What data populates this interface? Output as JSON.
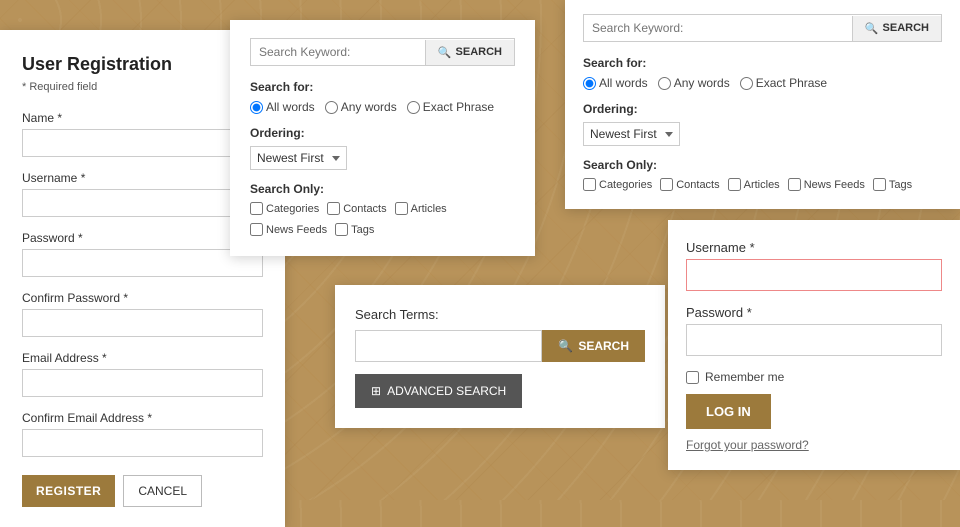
{
  "registration": {
    "title": "User Registration",
    "required_note": "* Required field",
    "fields": [
      {
        "label": "Name *",
        "type": "text",
        "name": "name"
      },
      {
        "label": "Username *",
        "type": "text",
        "name": "username"
      },
      {
        "label": "Password *",
        "type": "password",
        "name": "password"
      },
      {
        "label": "Confirm Password *",
        "type": "password",
        "name": "confirm_password"
      },
      {
        "label": "Email Address *",
        "type": "email",
        "name": "email"
      },
      {
        "label": "Confirm Email Address *",
        "type": "email",
        "name": "confirm_email"
      }
    ],
    "register_btn": "REGISTER",
    "cancel_btn": "CANCEL"
  },
  "search_top": {
    "placeholder": "Search Keyword:",
    "search_btn": "SEARCH",
    "search_for_label": "Search for:",
    "radio_options": [
      "All words",
      "Any words",
      "Exact Phrase"
    ],
    "ordering_label": "Ordering:",
    "ordering_option": "Newest First",
    "search_only_label": "Search Only:",
    "checkboxes": [
      "Categories",
      "Contacts",
      "Articles",
      "News Feeds",
      "Tags"
    ]
  },
  "search_right": {
    "placeholder": "Search Keyword:",
    "search_btn": "SEARCH",
    "search_for_label": "Search for:",
    "radio_options": [
      "All words",
      "Any words",
      "Exact Phrase"
    ],
    "ordering_label": "Ordering:",
    "ordering_option": "Newest First",
    "search_only_label": "Search Only:",
    "checkboxes": [
      "Categories",
      "Contacts",
      "Articles",
      "News Feeds",
      "Tags"
    ]
  },
  "search_bottom": {
    "terms_label": "Search Terms:",
    "search_btn": "SEARCH",
    "advanced_btn": "ADVANCED SEARCH"
  },
  "login": {
    "username_label": "Username *",
    "password_label": "Password *",
    "remember_label": "Remember me",
    "login_btn": "LOG IN",
    "forgot_link": "Forgot your password?"
  }
}
